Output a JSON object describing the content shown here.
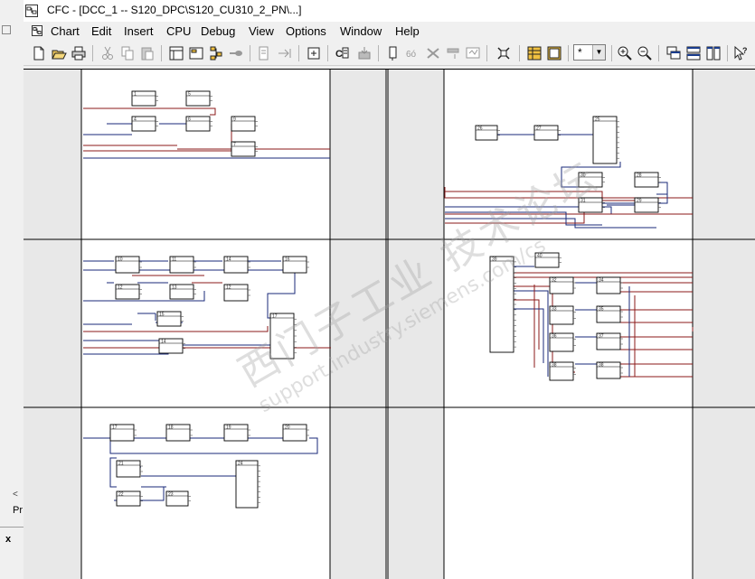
{
  "window": {
    "title": "CFC - [DCC_1 -- S120_DPC\\S120_CU310_2_PN\\...]"
  },
  "menu": [
    "Chart",
    "Edit",
    "Insert",
    "CPU",
    "Debug",
    "View",
    "Options",
    "Window",
    "Help"
  ],
  "toolbar": {
    "buttons": [
      "new-icon",
      "open-icon",
      "print-icon",
      "cut-icon",
      "copy-icon",
      "paste-icon",
      "catalog-icon",
      "overview-icon",
      "sheet-view-icon",
      "connect-icon",
      "run-sequence-icon",
      "insert-block-icon",
      "compile-icon",
      "download-icon",
      "test-mode-icon",
      "watch-icon",
      "stop-icon",
      "trace-icon",
      "chart-ref-icon",
      "fit-icon",
      "table-icon",
      "layout-icon",
      "zoom-in-icon",
      "zoom-out-icon",
      "cascade-icon",
      "tile-horizontal-icon",
      "tile-vertical-icon",
      "help-pointer-icon"
    ],
    "zoom_select": "*"
  },
  "left_panel": {
    "scroll_arrow": "<",
    "label": "Pr",
    "close": "x"
  },
  "watermark": {
    "line1": "西门子工业 技术论坛",
    "line2": "support.industry.siemens.com/cs"
  },
  "chart": {
    "sheets": [
      {
        "id": "1",
        "blocks": [
          {
            "no": "1"
          },
          {
            "no": "5"
          },
          {
            "no": "4"
          },
          {
            "no": "6"
          },
          {
            "no": "9"
          },
          {
            "no": "7"
          }
        ]
      },
      {
        "id": "2",
        "blocks": [
          {
            "no": "26"
          },
          {
            "no": "27"
          },
          {
            "no": "25"
          },
          {
            "no": "30"
          },
          {
            "no": "28"
          },
          {
            "no": "31"
          },
          {
            "no": "29"
          }
        ]
      },
      {
        "id": "3",
        "blocks": [
          {
            "no": "10"
          },
          {
            "no": "11"
          },
          {
            "no": "14"
          },
          {
            "no": "16"
          },
          {
            "no": "12"
          },
          {
            "no": "13"
          },
          {
            "no": "12"
          },
          {
            "no": "15"
          },
          {
            "no": "17"
          },
          {
            "no": "14"
          }
        ]
      },
      {
        "id": "4",
        "blocks": [
          {
            "no": "39"
          },
          {
            "no": "40"
          },
          {
            "no": "32"
          },
          {
            "no": "34"
          },
          {
            "no": "33"
          },
          {
            "no": "35"
          },
          {
            "no": "36"
          },
          {
            "no": "37"
          },
          {
            "no": "38"
          },
          {
            "no": "38"
          }
        ]
      },
      {
        "id": "5",
        "blocks": [
          {
            "no": "17"
          },
          {
            "no": "18"
          },
          {
            "no": "19"
          },
          {
            "no": "20"
          },
          {
            "no": "21"
          },
          {
            "no": "24"
          },
          {
            "no": "22"
          },
          {
            "no": "23"
          }
        ]
      }
    ]
  }
}
